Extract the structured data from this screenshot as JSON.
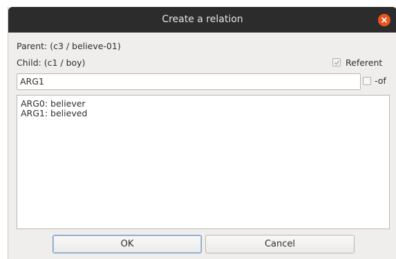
{
  "dialog": {
    "title": "Create a relation",
    "parent_text": "Parent: (c3 / believe-01)",
    "child_text": "Child: (c1 / boy)",
    "referent_label": "Referent",
    "referent_checked": true,
    "relation_value": "ARG1",
    "of_label": "-of",
    "of_checked": false,
    "roles": [
      "ARG0: believer",
      "ARG1: believed"
    ],
    "ok_label": "OK",
    "cancel_label": "Cancel"
  },
  "colors": {
    "titlebar": "#2c2c2c",
    "close_button": "#e95420",
    "dialog_background": "#efeeed"
  }
}
